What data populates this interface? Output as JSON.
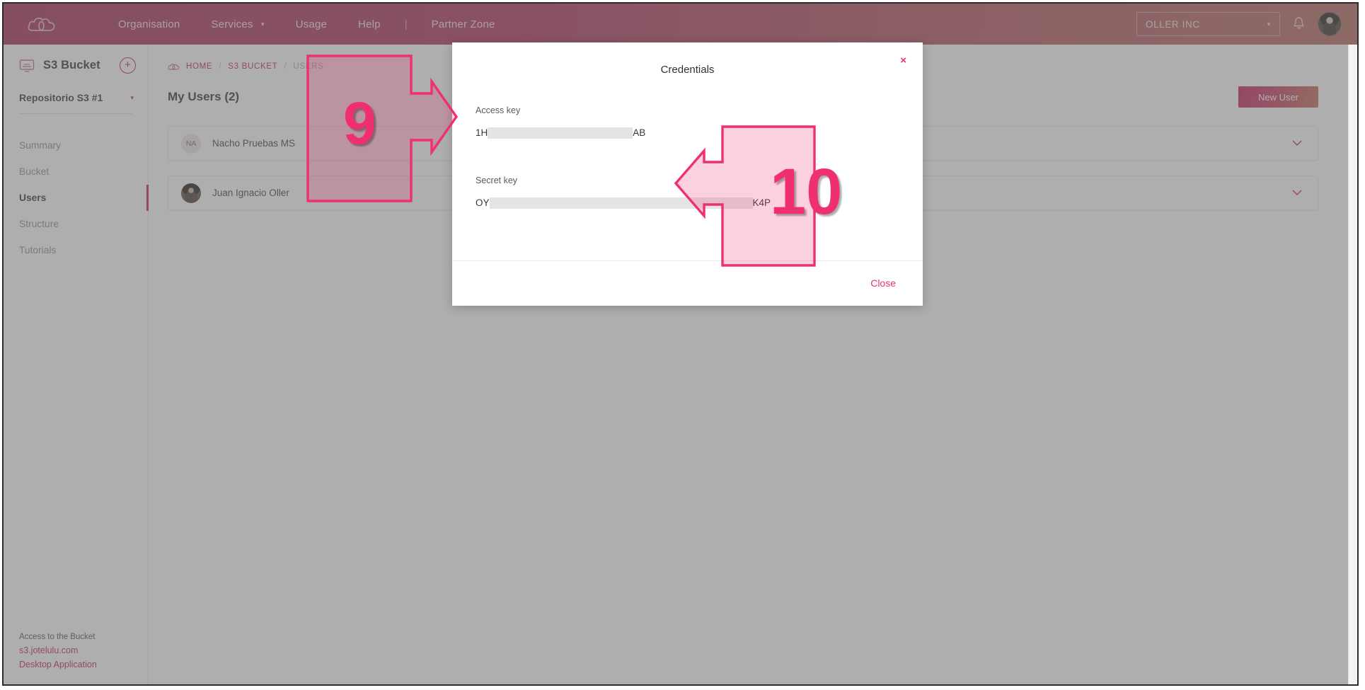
{
  "header": {
    "logo_icon": "cloud-icon",
    "nav": [
      {
        "label": "Organisation",
        "has_caret": false
      },
      {
        "label": "Services",
        "has_caret": true
      },
      {
        "label": "Usage",
        "has_caret": false
      },
      {
        "label": "Help",
        "has_caret": false
      },
      {
        "label": "Partner Zone",
        "has_caret": false
      }
    ],
    "divider": "|",
    "org_selector": {
      "value": "OLLER INC",
      "caret": "▾"
    },
    "bell_icon": "bell-icon",
    "avatar": "user-avatar"
  },
  "sidebar": {
    "bucket_icon": "bucket-icon",
    "title": "S3 Bucket",
    "add_label": "+",
    "repository": {
      "name": "Repositorio S3 #1",
      "caret": "▾"
    },
    "items": [
      {
        "label": "Summary",
        "active": false
      },
      {
        "label": "Bucket",
        "active": false
      },
      {
        "label": "Users",
        "active": true
      },
      {
        "label": "Structure",
        "active": false
      },
      {
        "label": "Tutorials",
        "active": false
      }
    ],
    "footer": {
      "label": "Access to the Bucket",
      "link_domain": "s3.jotelulu.com",
      "link_app": "Desktop Application"
    }
  },
  "main": {
    "breadcrumb": {
      "icon": "cloud-icon",
      "home": "HOME",
      "sep": "/",
      "section": "S3 BUCKET",
      "current": "USERS"
    },
    "page_title": "My Users (2)",
    "new_user_button": "New User",
    "users": [
      {
        "initials": "NA",
        "name": "Nacho Pruebas MS",
        "chevron": "⌄",
        "avatar_type": "initials"
      },
      {
        "initials": "",
        "name": "Juan Ignacio Oller",
        "chevron": "⌄",
        "avatar_type": "photo"
      }
    ]
  },
  "modal": {
    "title": "Credentials",
    "close_x": "×",
    "access_key": {
      "label": "Access key",
      "prefix": "1H",
      "suffix": "AB",
      "redacted": true
    },
    "secret_key": {
      "label": "Secret key",
      "prefix": "OY",
      "suffix": "K4P",
      "redacted": true
    },
    "close_button": "Close"
  },
  "annotations": [
    {
      "number": "9",
      "direction": "right"
    },
    {
      "number": "10",
      "direction": "left"
    }
  ],
  "colors": {
    "brand_pink": "#c0185c",
    "accent_pink": "#e8336f",
    "annotation_pink": "#ef2f6f",
    "header_gradient_start": "#a32654",
    "header_gradient_end": "#b5655b"
  }
}
